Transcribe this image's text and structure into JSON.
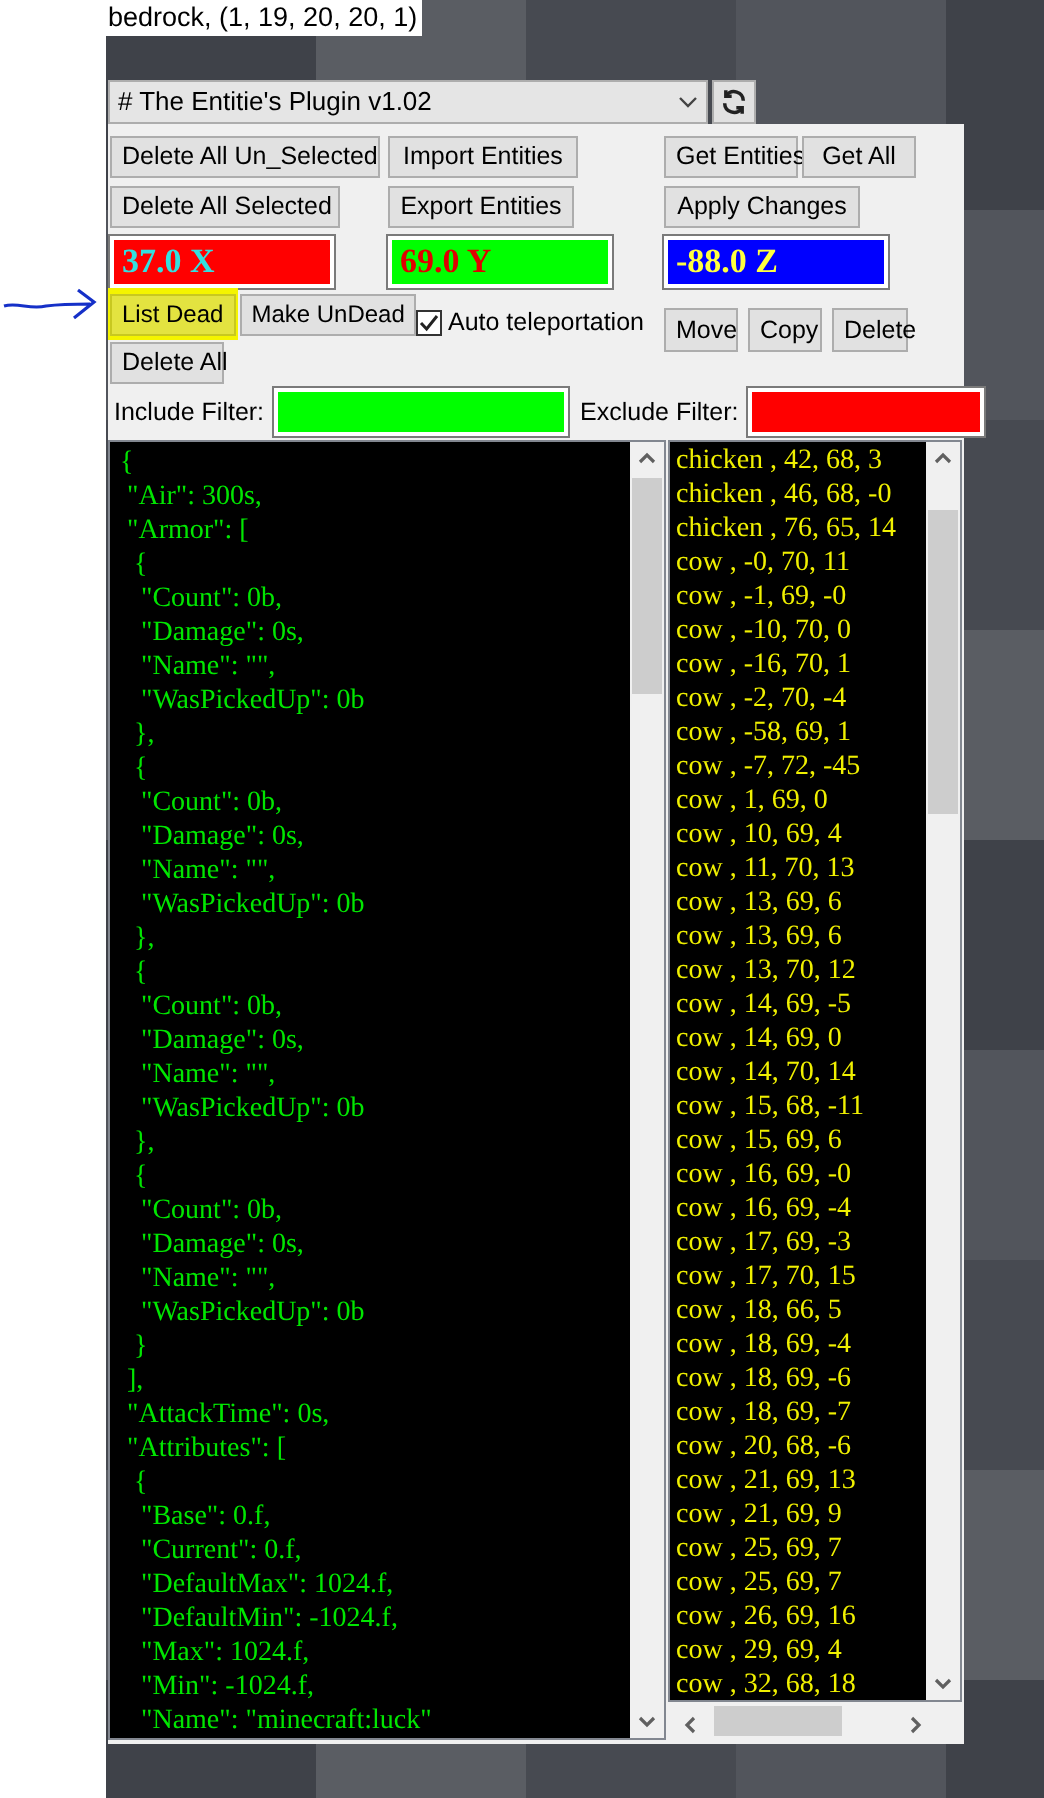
{
  "overlay_label": "bedrock, (1, 19, 20, 20, 1)",
  "plugin_select": {
    "value": "# The Entitie's Plugin v1.02"
  },
  "left_buttons": [
    {
      "label": "Delete All Un_Selected"
    },
    {
      "label": "Delete All Selected"
    }
  ],
  "middle_buttons": [
    {
      "label": "Import Entities"
    },
    {
      "label": "Export Entities"
    }
  ],
  "right_buttons_row1": [
    {
      "label": "Get Entities"
    },
    {
      "label": "Get All"
    }
  ],
  "apply_button": {
    "label": "Apply Changes"
  },
  "coordinates": [
    {
      "value": "37.0 X",
      "color": "#ff0000"
    },
    {
      "value": "69.0 Y",
      "color": "#00ff00"
    },
    {
      "value": "-88.0 Z",
      "color": "#0000ff"
    }
  ],
  "dead_buttons": [
    {
      "label": "List Dead",
      "highlighted": true
    },
    {
      "label": "Make UnDead",
      "highlighted": false
    }
  ],
  "delete_all_button": {
    "label": "Delete All"
  },
  "auto_teleportation": {
    "label": "Auto teleportation",
    "checked": true
  },
  "action_buttons": [
    {
      "label": "Move"
    },
    {
      "label": "Copy"
    },
    {
      "label": "Delete"
    }
  ],
  "filters": [
    {
      "label": "Include Filter:",
      "color": "#00ff00"
    },
    {
      "label": "Exclude Filter:",
      "color": "#ff0000"
    }
  ],
  "nbt_lines": [
    "{",
    " \"Air\": 300s,",
    " \"Armor\": [",
    "  {",
    "   \"Count\": 0b,",
    "   \"Damage\": 0s,",
    "   \"Name\": \"\",",
    "   \"WasPickedUp\": 0b",
    "  },",
    "  {",
    "   \"Count\": 0b,",
    "   \"Damage\": 0s,",
    "   \"Name\": \"\",",
    "   \"WasPickedUp\": 0b",
    "  },",
    "  {",
    "   \"Count\": 0b,",
    "   \"Damage\": 0s,",
    "   \"Name\": \"\",",
    "   \"WasPickedUp\": 0b",
    "  },",
    "  {",
    "   \"Count\": 0b,",
    "   \"Damage\": 0s,",
    "   \"Name\": \"\",",
    "   \"WasPickedUp\": 0b",
    "  }",
    " ],",
    " \"AttackTime\": 0s,",
    " \"Attributes\": [",
    "  {",
    "   \"Base\": 0.f,",
    "   \"Current\": 0.f,",
    "   \"DefaultMax\": 1024.f,",
    "   \"DefaultMin\": -1024.f,",
    "   \"Max\": 1024.f,",
    "   \"Min\": -1024.f,",
    "   \"Name\": \"minecraft:luck\""
  ],
  "entities": [
    "chicken , 42, 68, 3",
    "chicken , 46, 68, -0",
    "chicken , 76, 65, 14",
    "cow , -0, 70, 11",
    "cow , -1, 69, -0",
    "cow , -10, 70, 0",
    "cow , -16, 70, 1",
    "cow , -2, 70, -4",
    "cow , -58, 69, 1",
    "cow , -7, 72, -45",
    "cow , 1, 69, 0",
    "cow , 10, 69, 4",
    "cow , 11, 70, 13",
    "cow , 13, 69, 6",
    "cow , 13, 69, 6",
    "cow , 13, 70, 12",
    "cow , 14, 69, -5",
    "cow , 14, 69, 0",
    "cow , 14, 70, 14",
    "cow , 15, 68, -11",
    "cow , 15, 69, 6",
    "cow , 16, 69, -0",
    "cow , 16, 69, -4",
    "cow , 17, 69, -3",
    "cow , 17, 70, 15",
    "cow , 18, 66, 5",
    "cow , 18, 69, -4",
    "cow , 18, 69, -6",
    "cow , 18, 69, -7",
    "cow , 20, 68, -6",
    "cow , 21, 69, 13",
    "cow , 21, 69, 9",
    "cow , 25, 69, 7",
    "cow , 25, 69, 7",
    "cow , 26, 69, 16",
    "cow , 29, 69, 4",
    "cow , 32, 68, 18"
  ]
}
